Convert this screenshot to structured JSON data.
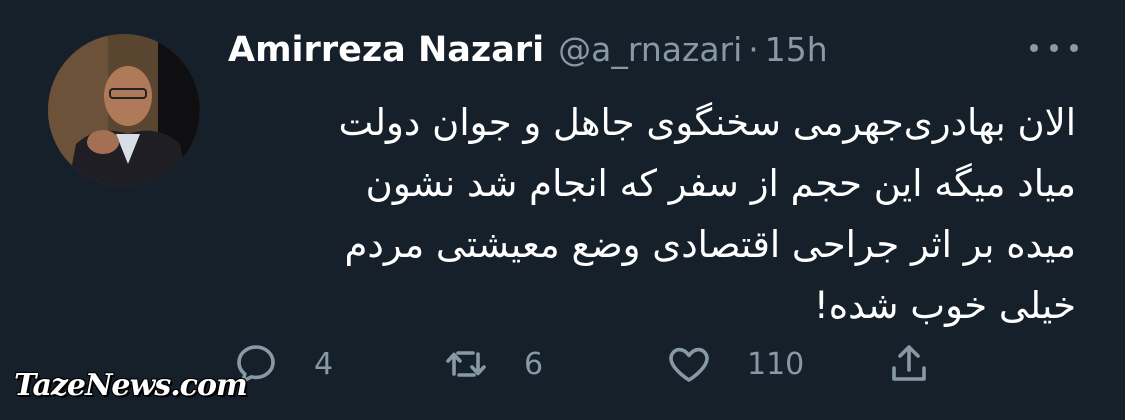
{
  "tweet": {
    "author_name": "Amirreza Nazari",
    "handle": "@a_rnazari",
    "separator": "·",
    "time": "15h",
    "text": "الان بهادری‌جهرمی سخنگوی جاهل و جوان دولت\nمیاد میگه این حجم از سفر که انجام شد نشون\nمیده بر اثر جراحی اقتصادی وضع معیشتی مردم\nخیلی خوب شده!"
  },
  "actions": {
    "reply_count": "4",
    "retweet_count": "6",
    "like_count": "110"
  },
  "watermark": "TazeNews.com",
  "icons": {
    "more": "more-horizontal-icon",
    "reply": "reply-icon",
    "retweet": "retweet-icon",
    "like": "heart-icon",
    "share": "share-icon"
  },
  "colors": {
    "background": "#15202b",
    "text": "#ffffff",
    "secondary": "#8899a6"
  }
}
